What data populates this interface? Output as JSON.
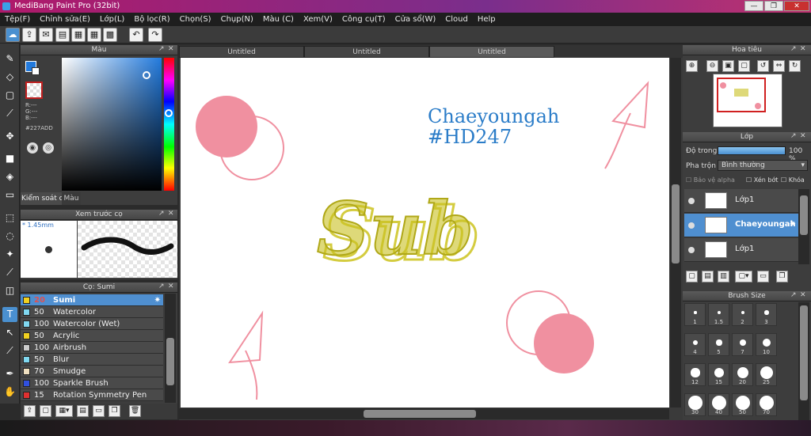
{
  "window": {
    "title": "MediBang Paint Pro (32bit)"
  },
  "menu": [
    "Tệp(F)",
    "Chỉnh sửa(E)",
    "Lớp(L)",
    "Bộ lọc(R)",
    "Chọn(S)",
    "Chụp(N)",
    "Màu (C)",
    "Xem(V)",
    "Công cụ(T)",
    "Cửa sổ(W)",
    "Cloud",
    "Help"
  ],
  "color_panel": {
    "title": "Màu",
    "r": "R:---",
    "g": "G:---",
    "b": "B:---",
    "hex": "#227ADD",
    "tab_brush_control": "Kiểm soát cọ",
    "tab_color": "Màu",
    "accent": "#227ADD"
  },
  "brush_preview": {
    "title": "Xem trước cọ",
    "size": "1.45mm"
  },
  "brush_list": {
    "title": "Cọ: Sumi",
    "items": [
      {
        "size": "20",
        "name": "Sumi",
        "color": "#f0d020"
      },
      {
        "size": "50",
        "name": "Watercolor",
        "color": "#80d8f0"
      },
      {
        "size": "100",
        "name": "Watercolor (Wet)",
        "color": "#80d8f0"
      },
      {
        "size": "50",
        "name": "Acrylic",
        "color": "#f0d020"
      },
      {
        "size": "100",
        "name": "Airbrush",
        "color": "#cccccc"
      },
      {
        "size": "50",
        "name": "Blur",
        "color": "#80d8f0"
      },
      {
        "size": "70",
        "name": "Smudge",
        "color": "#f0e0c0"
      },
      {
        "size": "100",
        "name": "Sparkle Brush",
        "color": "#3050e0"
      },
      {
        "size": "15",
        "name": "Rotation Symmetry Pen",
        "color": "#e03030"
      }
    ]
  },
  "tabs": [
    "Untitled",
    "Untitled",
    "Untitled"
  ],
  "canvas": {
    "text_line1": "Chaeyoungah",
    "text_line2": "#HD247",
    "text_main": "Sub",
    "text_color": "#2a7cc8",
    "main_color": "#c8c020",
    "pink": "#f090a0"
  },
  "navigator": {
    "title": "Hoa tiêu"
  },
  "layers": {
    "title": "Lớp",
    "opacity_label": "Độ trong",
    "opacity_value": "100 %",
    "blend_label": "Pha trộn",
    "blend_value": "Bình thường",
    "protect_alpha": "Bảo vệ alpha",
    "clipping": "Xén bớt",
    "lock": "Khóa",
    "items": [
      "Lớp1",
      "Chaeyoungah",
      "Lớp1"
    ]
  },
  "brush_size": {
    "title": "Brush Size",
    "sizes": [
      "1",
      "1.5",
      "2",
      "3",
      "4",
      "5",
      "7",
      "10",
      "12",
      "15",
      "20",
      "25",
      "30",
      "40",
      "50",
      "70"
    ]
  }
}
